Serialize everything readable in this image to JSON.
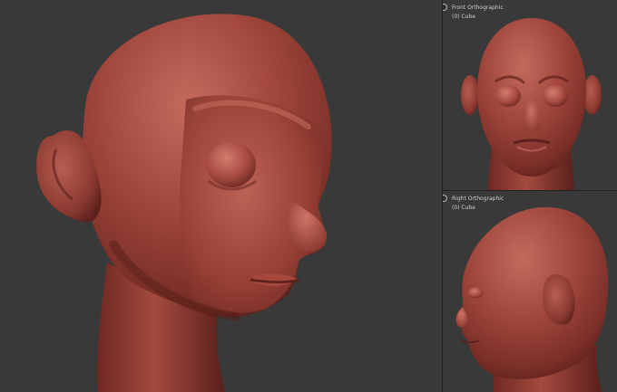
{
  "viewports": {
    "main": {
      "view": "perspective",
      "subject": "sculpted-head-three-quarter"
    },
    "front": {
      "view_label": "Front Orthographic",
      "object_label": "(0) Cube"
    },
    "right": {
      "view_label": "Right Orthographic",
      "object_label": "(0) Cube"
    }
  },
  "colors": {
    "background": "#393939",
    "divider": "#1f1f1f",
    "clay_base": "#9a3f36",
    "clay_highlight": "#c96c5f",
    "clay_shadow": "#5e211c",
    "label_text": "#e8e8e8"
  }
}
